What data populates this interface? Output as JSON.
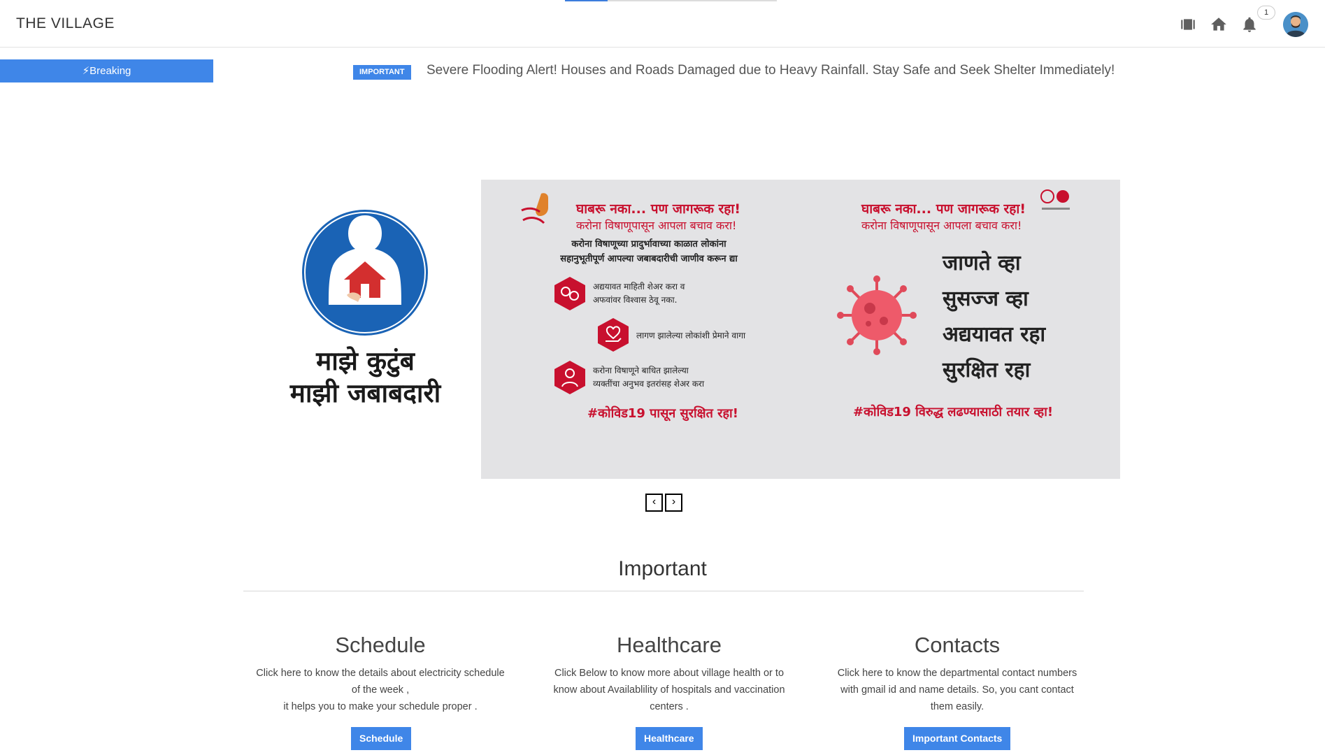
{
  "app": {
    "title": "THE VILLAGE"
  },
  "header": {
    "progress_fraction": 0.2,
    "icons": [
      "film-strip-icon",
      "home-icon",
      "bell-icon"
    ],
    "notification_count": "1",
    "accent": "#3f86e8"
  },
  "breaking": {
    "button_label": "Breaking",
    "tag": "IMPORTANT",
    "message": "Severe Flooding Alert! Houses and Roads Damaged due to Heavy Rainfall. Stay Safe and Seek Shelter Immediately!"
  },
  "carousel": {
    "left_caption_line1": "माझे कुटुंब",
    "left_caption_line2": "माझी जबाबदारी",
    "banner": {
      "title_left": "घाबरू नका... पण जागरूक रहा!",
      "sub_left": "करोना विषाणूपासून आपला बचाव करा!",
      "body_line1": "करोना विषाणूच्या प्रादुर्भावाच्या काळात लोकांना",
      "body_line2": "सहानुभूतीपूर्ण आपल्या जबाबदारीची जाणीव करून द्या",
      "item1_line1": "अद्ययावत माहिती शेअर करा व",
      "item1_line2": "अफवांवर विश्वास ठेवू नका.",
      "item2": "लागण झालेल्या लोकांशी प्रेमाने वागा",
      "item3_line1": "करोना विषाणूने बाधित झालेल्या",
      "item3_line2": "व्यक्तींचा अनुभव इतरांसह शेअर करा",
      "hash_left": "#कोविड19 पासून सुरक्षित रहा!",
      "title_right": "घाबरू नका... पण जागरूक रहा!",
      "sub_right": "करोना विषाणूपासून आपला बचाव करा!",
      "big1": "जाणते व्हा",
      "big2": "सुसज्ज व्हा",
      "big3": "अद्ययावत रहा",
      "big4": "सुरक्षित रहा",
      "hash_right": "#कोविड19 विरुद्ध लढण्यासाठी तयार व्हा!"
    },
    "prev_label": "‹",
    "next_label": "›"
  },
  "important": {
    "title": "Important",
    "cards": [
      {
        "title": "Schedule",
        "line1": "Click here to know the details about electricity schedule",
        "line2": "of the week ,",
        "line3": "it helps you to make your schedule proper .",
        "button": "Schedule"
      },
      {
        "title": "Healthcare",
        "line1": "Click Below to know more about village health or to",
        "line2": "know about Availablility of hospitals and vaccination",
        "line3": "centers .",
        "button": "Healthcare"
      },
      {
        "title": "Contacts",
        "line1": "Click here to know the departmental contact numbers",
        "line2": "with gmail id and name details. So, you cant contact",
        "line3": "them easily.",
        "button": "Important Contacts"
      }
    ]
  }
}
